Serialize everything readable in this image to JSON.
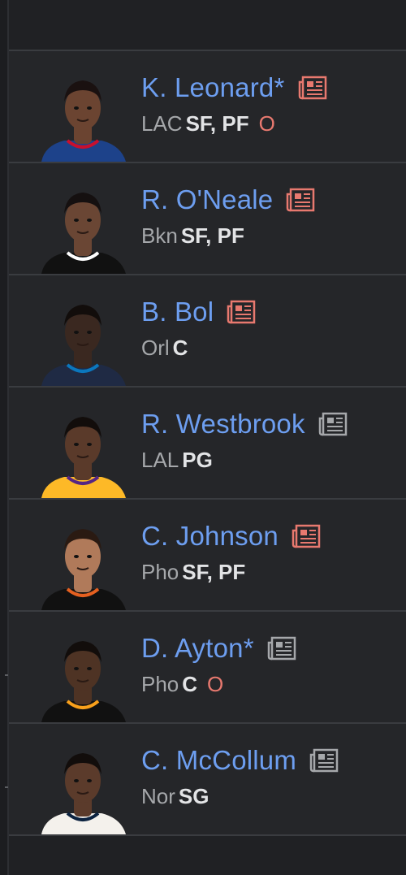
{
  "colors": {
    "link_blue": "#6d9ef0",
    "status_red": "#e8796f",
    "news_red": "#e8796f",
    "news_gray": "#a6a8ab"
  },
  "players": [
    {
      "name": "K. Leonard*",
      "team": "LAC",
      "positions": "SF, PF",
      "status": "O",
      "news_icon": "news-icon-red",
      "jersey": "#1d428a",
      "trim": "#c8102e",
      "skin": "#6b4431",
      "hair": "#1a1110"
    },
    {
      "name": "R. O'Neale",
      "team": "Bkn",
      "positions": "SF, PF",
      "status": "",
      "news_icon": "news-icon-red",
      "jersey": "#111111",
      "trim": "#ffffff",
      "skin": "#6a4634",
      "hair": "#151010"
    },
    {
      "name": "B. Bol",
      "team": "Orl",
      "positions": "C",
      "status": "",
      "news_icon": "news-icon-red",
      "jersey": "#1f2a44",
      "trim": "#0b77bd",
      "skin": "#3a2820",
      "hair": "#120d0b"
    },
    {
      "name": "R. Westbrook",
      "team": "LAL",
      "positions": "PG",
      "status": "",
      "news_icon": "news-icon-gray",
      "jersey": "#fdb927",
      "trim": "#552583",
      "skin": "#5a3a2a",
      "hair": "#120d0b"
    },
    {
      "name": "C. Johnson",
      "team": "Pho",
      "positions": "SF, PF",
      "status": "",
      "news_icon": "news-icon-red",
      "jersey": "#111111",
      "trim": "#e56020",
      "skin": "#b07a5a",
      "hair": "#2a1a12"
    },
    {
      "name": "D. Ayton*",
      "team": "Pho",
      "positions": "C",
      "status": "O",
      "news_icon": "news-icon-gray",
      "jersey": "#111111",
      "trim": "#f9a01b",
      "skin": "#4e3324",
      "hair": "#120d0b"
    },
    {
      "name": "C. McCollum",
      "team": "Nor",
      "positions": "SG",
      "status": "",
      "news_icon": "news-icon-gray",
      "jersey": "#f4f1ec",
      "trim": "#0c2340",
      "skin": "#5b3b2b",
      "hair": "#120d0b"
    }
  ]
}
